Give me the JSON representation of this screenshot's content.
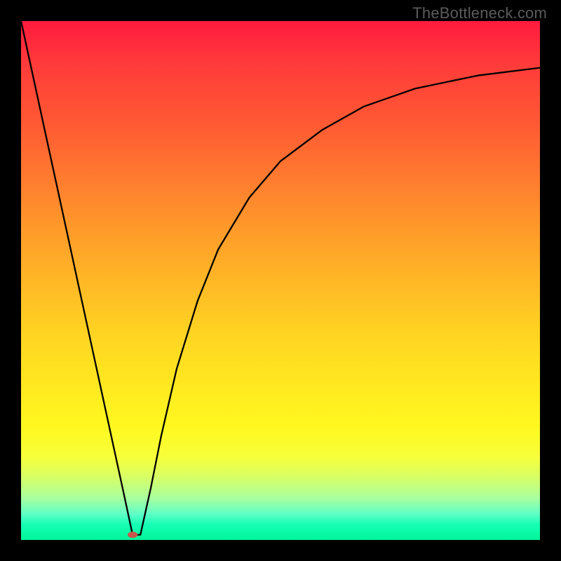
{
  "watermark": "TheBottleneck.com",
  "chart_data": {
    "type": "line",
    "title": "",
    "xlabel": "",
    "ylabel": "",
    "xlim": [
      0,
      100
    ],
    "ylim": [
      0,
      100
    ],
    "series": [
      {
        "name": "curve",
        "x": [
          0,
          5,
          10,
          15,
          20,
          21.5,
          23,
          25,
          27,
          30,
          34,
          38,
          44,
          50,
          58,
          66,
          76,
          88,
          100
        ],
        "y": [
          100,
          77,
          54,
          31,
          8,
          1,
          1,
          10,
          20,
          33,
          46,
          56,
          66,
          73,
          79,
          83.5,
          87,
          89.5,
          91
        ]
      }
    ],
    "marker": {
      "x": 21.5,
      "y": 1,
      "color": "#c9564b",
      "rx": 7,
      "ry": 4.5
    }
  }
}
